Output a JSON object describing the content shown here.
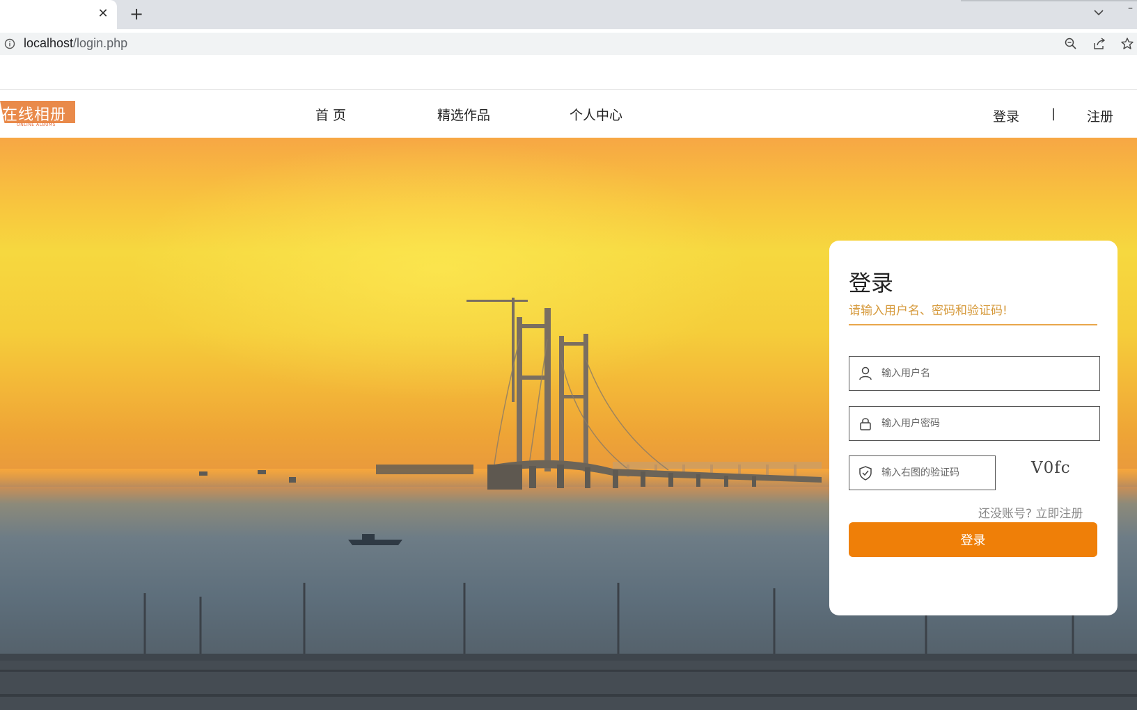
{
  "browser": {
    "tab_close": "✕",
    "new_tab": "+",
    "url_host": "localhost",
    "url_path": "/login.php",
    "window_minimize": "–"
  },
  "site": {
    "logo_text": "在线相册",
    "logo_subtext": "ONLINE ALBUMS",
    "nav": [
      {
        "label": "首 页"
      },
      {
        "label": "精选作品"
      },
      {
        "label": "个人中心"
      }
    ],
    "login_link": "登录",
    "separator": "|",
    "register_link": "注册"
  },
  "login_form": {
    "title": "登录",
    "subtitle": "请输入用户名、密码和验证码!",
    "username_placeholder": "输入用户名",
    "password_placeholder": "输入用户密码",
    "captcha_placeholder": "输入右图的验证码",
    "captcha_text": "V0fc",
    "register_prompt": "还没账号? 立即注册",
    "submit_label": "登录"
  },
  "colors": {
    "accent": "#ef7f08",
    "subtitle": "#d69a3c",
    "logo_bg": "#e98a4a"
  }
}
